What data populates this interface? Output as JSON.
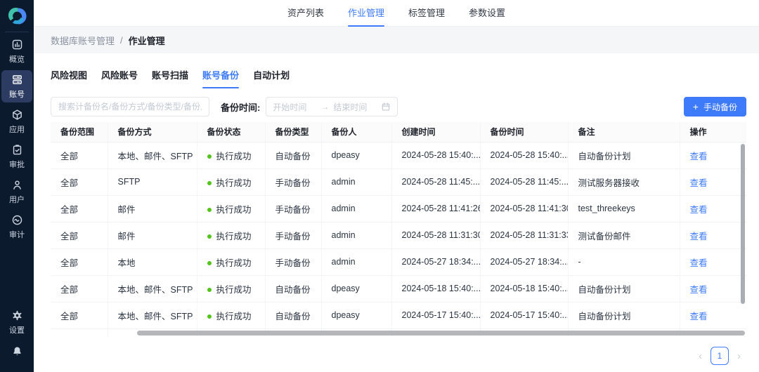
{
  "sidebar": {
    "items": [
      {
        "label": "概览",
        "icon": "overview-icon"
      },
      {
        "label": "账号",
        "icon": "accounts-icon"
      },
      {
        "label": "应用",
        "icon": "apps-icon"
      },
      {
        "label": "审批",
        "icon": "approval-icon"
      },
      {
        "label": "用户",
        "icon": "users-icon"
      },
      {
        "label": "审计",
        "icon": "audit-icon"
      }
    ],
    "settings": {
      "label": "设置",
      "icon": "settings-icon"
    }
  },
  "topnav": {
    "items": [
      {
        "label": "资产列表"
      },
      {
        "label": "作业管理"
      },
      {
        "label": "标签管理"
      },
      {
        "label": "参数设置"
      }
    ]
  },
  "breadcrumb": {
    "parent": "数据库账号管理",
    "separator": "/",
    "current": "作业管理"
  },
  "tabs": {
    "items": [
      {
        "label": "风险视图"
      },
      {
        "label": "风险账号"
      },
      {
        "label": "账号扫描"
      },
      {
        "label": "账号备份"
      },
      {
        "label": "自动计划"
      }
    ]
  },
  "toolbar": {
    "search_placeholder": "搜索计备份名/备份方式/备份类型/备份人",
    "date_label": "备份时间:",
    "date_start_placeholder": "开始时间",
    "date_arrow": "→",
    "date_end_placeholder": "结束时间",
    "backup_button": {
      "plus": "+",
      "label": "手动备份"
    }
  },
  "table": {
    "columns": [
      "备份范围",
      "备份方式",
      "备份状态",
      "备份类型",
      "备份人",
      "创建时间",
      "备份时间",
      "备注",
      "操作"
    ],
    "action_label": "查看",
    "rows": [
      {
        "scope": "全部",
        "method": "本地、邮件、SFTP",
        "status": "执行成功",
        "type": "自动备份",
        "operator": "dpeasy",
        "created": "2024-05-28 15:40:...",
        "backup_time": "2024-05-28 15:40:...",
        "note": "自动备份计划"
      },
      {
        "scope": "全部",
        "method": "SFTP",
        "status": "执行成功",
        "type": "手动备份",
        "operator": "admin",
        "created": "2024-05-28 11:45:...",
        "backup_time": "2024-05-28 11:45:...",
        "note": "测试服务器接收"
      },
      {
        "scope": "全部",
        "method": "邮件",
        "status": "执行成功",
        "type": "手动备份",
        "operator": "admin",
        "created": "2024-05-28 11:41:26",
        "backup_time": "2024-05-28 11:41:30",
        "note": "test_threekeys"
      },
      {
        "scope": "全部",
        "method": "邮件",
        "status": "执行成功",
        "type": "手动备份",
        "operator": "admin",
        "created": "2024-05-28 11:31:30",
        "backup_time": "2024-05-28 11:31:33",
        "note": "测试备份邮件"
      },
      {
        "scope": "全部",
        "method": "本地",
        "status": "执行成功",
        "type": "手动备份",
        "operator": "admin",
        "created": "2024-05-27 18:34:...",
        "backup_time": "2024-05-27 18:34:...",
        "note": "-"
      },
      {
        "scope": "全部",
        "method": "本地、邮件、SFTP",
        "status": "执行成功",
        "type": "自动备份",
        "operator": "dpeasy",
        "created": "2024-05-18 15:40:...",
        "backup_time": "2024-05-18 15:40:...",
        "note": "自动备份计划"
      },
      {
        "scope": "全部",
        "method": "本地、邮件、SFTP",
        "status": "执行成功",
        "type": "自动备份",
        "operator": "dpeasy",
        "created": "2024-05-17 15:40:...",
        "backup_time": "2024-05-17 15:40:...",
        "note": "自动备份计划"
      }
    ]
  },
  "pagination": {
    "prev": "‹",
    "current": "1",
    "next": "›"
  },
  "colors": {
    "accent": "#3e7bfa",
    "sidebar_bg": "#0c1a2e",
    "active_item_bg": "#2b3b61",
    "status_green": "#52c41a"
  }
}
